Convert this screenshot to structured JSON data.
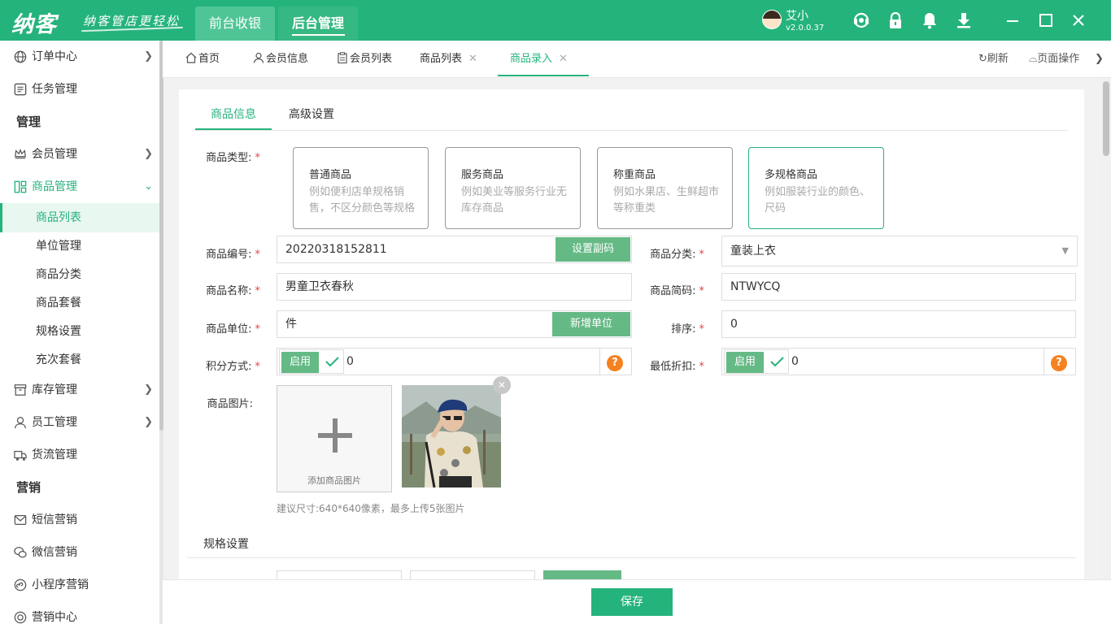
{
  "app": {
    "logo": "纳客",
    "slogan": "纳客管店更轻松",
    "top_tabs": [
      "前台收银",
      "后台管理"
    ],
    "user_name": "艾小",
    "version": "v2.0.0.37"
  },
  "sidebar": {
    "items": [
      {
        "label": "订单中心",
        "icon": "globe-icon"
      },
      {
        "label": "任务管理",
        "icon": "task-icon"
      },
      {
        "label": "管理"
      },
      {
        "label": "会员管理",
        "icon": "crown-icon"
      },
      {
        "label": "商品管理",
        "icon": "goods-icon"
      },
      {
        "label": "商品列表"
      },
      {
        "label": "单位管理"
      },
      {
        "label": "商品分类"
      },
      {
        "label": "商品套餐"
      },
      {
        "label": "规格设置"
      },
      {
        "label": "充次套餐"
      },
      {
        "label": "库存管理",
        "icon": "inventory-icon"
      },
      {
        "label": "员工管理",
        "icon": "staff-icon"
      },
      {
        "label": "货流管理",
        "icon": "truck-icon"
      },
      {
        "label": "营销"
      },
      {
        "label": "短信营销",
        "icon": "mail-icon"
      },
      {
        "label": "微信营销",
        "icon": "wechat-icon"
      },
      {
        "label": "小程序营销",
        "icon": "miniprogram-icon"
      },
      {
        "label": "营销中心",
        "icon": "target-icon"
      }
    ]
  },
  "tabs": {
    "items": [
      {
        "label": "首页"
      },
      {
        "label": "会员信息"
      },
      {
        "label": "会员列表"
      },
      {
        "label": "商品列表"
      },
      {
        "label": "商品录入"
      }
    ],
    "refresh": "刷新",
    "page_ops": "页面操作",
    "close_glyph": "✕"
  },
  "form": {
    "subtabs": [
      "商品信息",
      "高级设置"
    ],
    "type_label": "商品类型:",
    "required_mark": "*",
    "types": [
      {
        "title": "普通商品",
        "desc": "例如便利店单规格销售，不区分颜色等规格"
      },
      {
        "title": "服务商品",
        "desc": "例如美业等服务行业无库存商品"
      },
      {
        "title": "称重商品",
        "desc": "例如水果店、生鲜超市等称重类"
      },
      {
        "title": "多规格商品",
        "desc": "例如服装行业的颜色、尺码"
      }
    ],
    "code_label": "商品编号:",
    "code_value": "20220318152811",
    "set_subcode": "设置副码",
    "category_label": "商品分类:",
    "category_value": "童装上衣",
    "name_label": "商品名称:",
    "name_value": "男童卫衣春秋",
    "shortcode_label": "商品简码:",
    "shortcode_value": "NTWYCQ",
    "unit_label": "商品单位:",
    "unit_value": "件",
    "add_unit": "新增单位",
    "sort_label": "排序:",
    "sort_value": "0",
    "points_label": "积分方式:",
    "points_toggle": "启用",
    "points_value": "0",
    "discount_label": "最低折扣:",
    "discount_toggle": "启用",
    "discount_value": "0",
    "help_glyph": "?",
    "image_label": "商品图片:",
    "add_image": "添加商品图片",
    "image_hint": "建议尺寸:640*640像素，最多上传5张图片",
    "spec_section": "规格设置"
  },
  "footer": {
    "save": "保存"
  },
  "colors": {
    "brand": "#25b37c",
    "button_green": "#64b985",
    "help_orange": "#f58220",
    "required_red": "#e64340"
  }
}
